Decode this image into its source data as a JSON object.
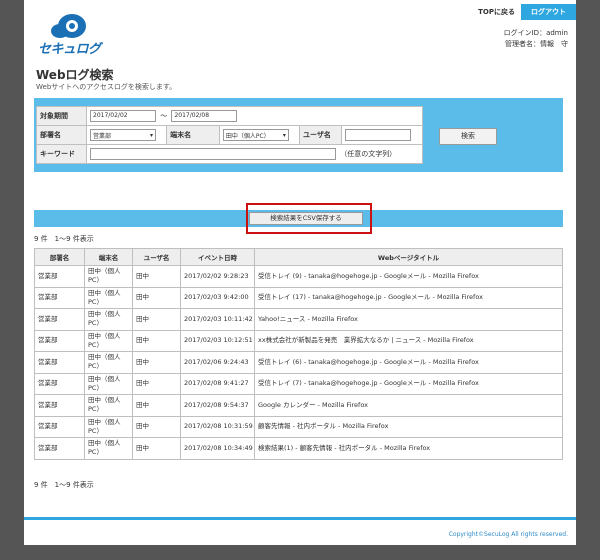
{
  "header": {
    "top_link": "TOPに戻る",
    "logout": "ログアウト",
    "logo_text": "セキュログ",
    "login_id": "ログインID：admin",
    "admin_name": "管理者名：情報　守"
  },
  "page": {
    "title": "Webログ検索",
    "subtitle": "Webサイトへのアクセスログを検索します。"
  },
  "search": {
    "period_label": "対象期間",
    "date_from": "2017/02/02",
    "date_sep": "～",
    "date_to": "2017/02/08",
    "dept_label": "部署名",
    "dept_value": "営業部",
    "terminal_label": "端末名",
    "terminal_value": "田中（個人PC）",
    "user_label": "ユーザ名",
    "user_value": "",
    "keyword_label": "キーワード",
    "keyword_value": "",
    "keyword_hint": "（任意の文字列）",
    "search_button": "検索"
  },
  "csv": {
    "button": "検索結果をCSV保存する"
  },
  "results": {
    "count_text": "9 件　1～9 件表示",
    "columns": [
      "部署名",
      "端末名",
      "ユーザ名",
      "イベント日時",
      "Webページタイトル"
    ],
    "rows": [
      {
        "dept": "営業部",
        "terminal": "田中（個人PC）",
        "user": "田中",
        "datetime": "2017/02/02 9:28:23",
        "title": "受信トレイ (9) - tanaka@hogehoge.jp - Googleメール - Mozilla Firefox"
      },
      {
        "dept": "営業部",
        "terminal": "田中（個人PC）",
        "user": "田中",
        "datetime": "2017/02/03 9:42:00",
        "title": "受信トレイ (17) - tanaka@hogehoge.jp - Googleメール - Mozilla Firefox"
      },
      {
        "dept": "営業部",
        "terminal": "田中（個人PC）",
        "user": "田中",
        "datetime": "2017/02/03 10:11:42",
        "title": "Yahoo!ニュース - Mozilla Firefox"
      },
      {
        "dept": "営業部",
        "terminal": "田中（個人PC）",
        "user": "田中",
        "datetime": "2017/02/03 10:12:51",
        "title": "xx株式会社が新製品を発売　業界拡大なるか | ニュース - Mozilla Firefox"
      },
      {
        "dept": "営業部",
        "terminal": "田中（個人PC）",
        "user": "田中",
        "datetime": "2017/02/06 9:24:43",
        "title": "受信トレイ (6) - tanaka@hogehoge.jp - Googleメール - Mozilla Firefox"
      },
      {
        "dept": "営業部",
        "terminal": "田中（個人PC）",
        "user": "田中",
        "datetime": "2017/02/08 9:41:27",
        "title": "受信トレイ (7) - tanaka@hogehoge.jp - Googleメール - Mozilla Firefox"
      },
      {
        "dept": "営業部",
        "terminal": "田中（個人PC）",
        "user": "田中",
        "datetime": "2017/02/08 9:54:37",
        "title": "Google カレンダー - Mozilla Firefox"
      },
      {
        "dept": "営業部",
        "terminal": "田中（個人PC）",
        "user": "田中",
        "datetime": "2017/02/08 10:31:59",
        "title": "顧客先情報 - 社内ポータル - Mozilla Firefox"
      },
      {
        "dept": "営業部",
        "terminal": "田中（個人PC）",
        "user": "田中",
        "datetime": "2017/02/08 10:34:49",
        "title": "検索結果(1) - 顧客先情報 - 社内ポータル - Mozilla Firefox"
      }
    ]
  },
  "footer": {
    "copyright": "Copyright©SecuLog All rights reserved."
  },
  "colors": {
    "accent": "#2ea7e0",
    "panel": "#5bbcea",
    "highlight": "#cc1111"
  }
}
